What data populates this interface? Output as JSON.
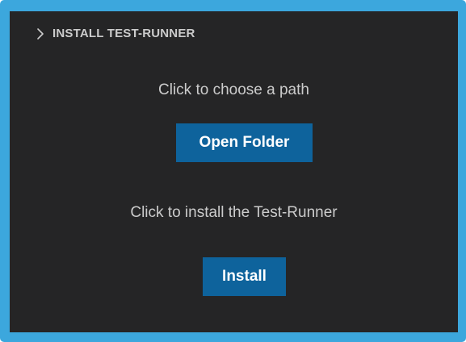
{
  "section": {
    "title": "INSTALL TEST-RUNNER",
    "expand_icon": "chevron-right-icon"
  },
  "path_step": {
    "prompt": "Click to choose a path",
    "button_label": "Open Folder"
  },
  "install_step": {
    "prompt": "Click to install the Test-Runner",
    "button_label": "Install"
  },
  "colors": {
    "frame_border": "#3ca7dd",
    "panel_background": "#252526",
    "text": "#cccccc",
    "button_background": "#0e639c",
    "button_text": "#ffffff"
  }
}
